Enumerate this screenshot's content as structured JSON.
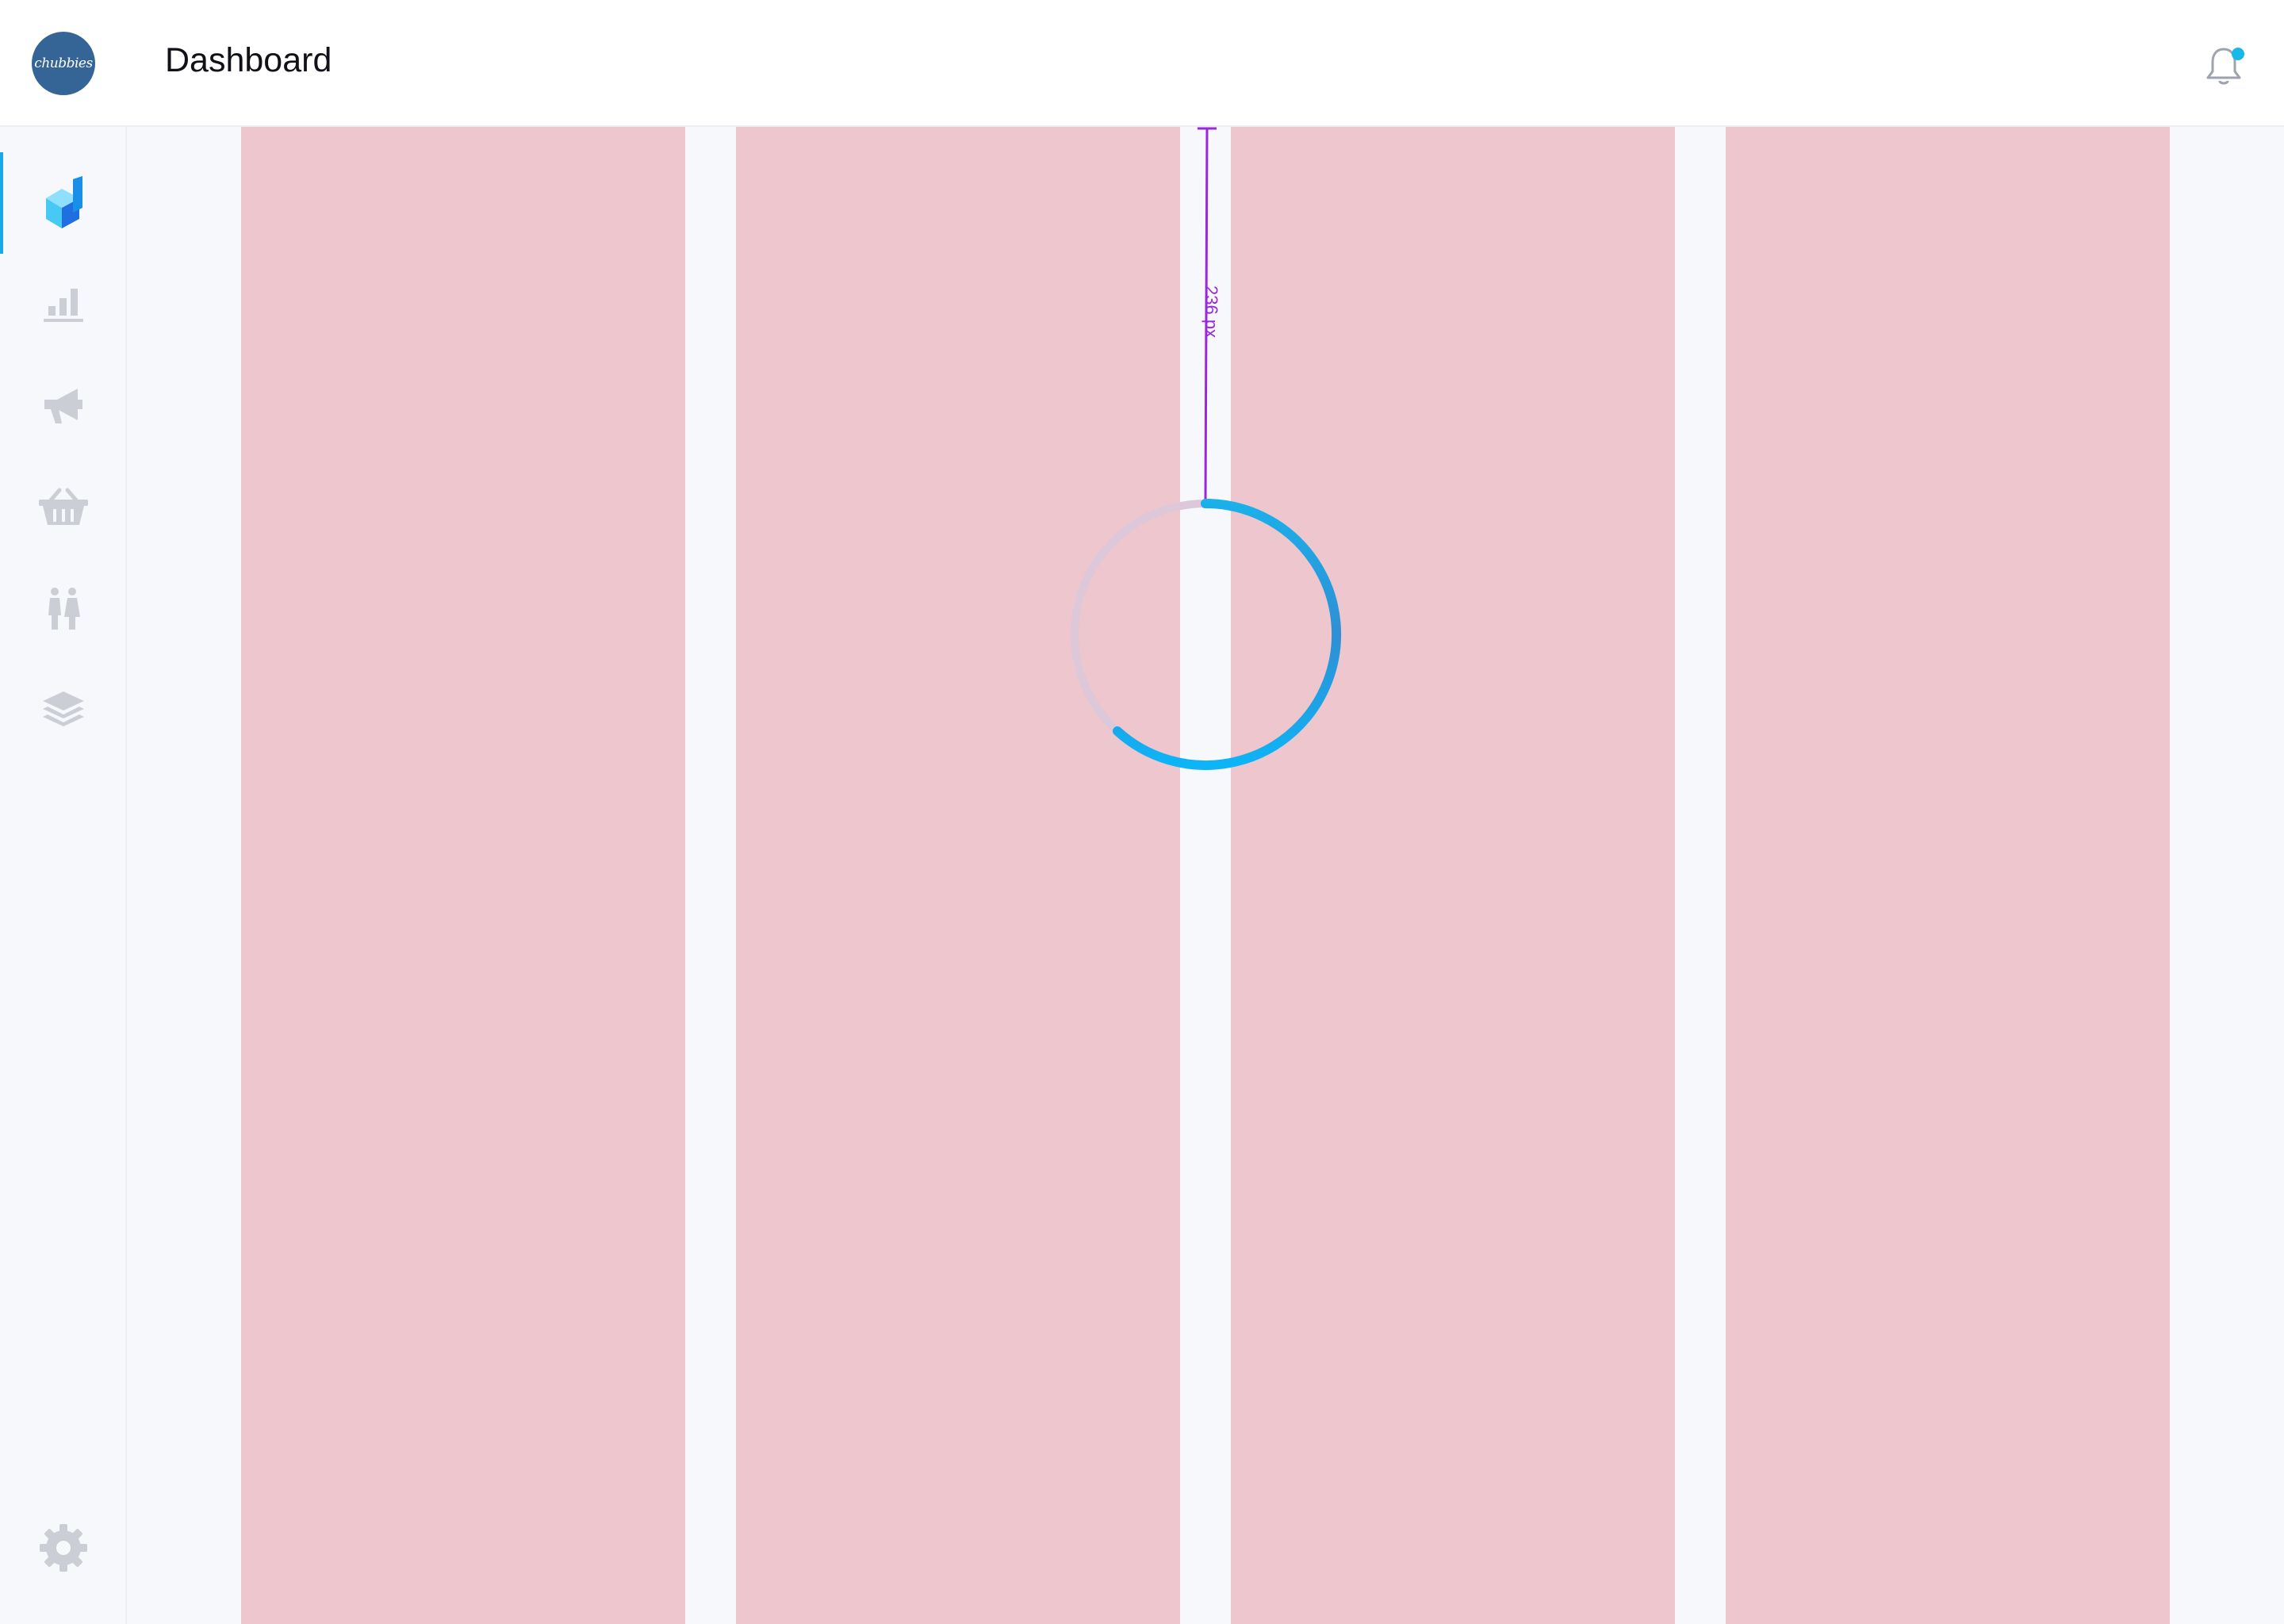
{
  "sidebar": {
    "logo_text": "chubbies",
    "nav": [
      {
        "icon": "brand-cube-icon",
        "active": true
      },
      {
        "icon": "bar-chart-icon",
        "active": false
      },
      {
        "icon": "megaphone-icon",
        "active": false
      },
      {
        "icon": "basket-icon",
        "active": false
      },
      {
        "icon": "people-icon",
        "active": false
      },
      {
        "icon": "layers-icon",
        "active": false
      }
    ],
    "settings_icon": "gear-icon"
  },
  "header": {
    "title": "Dashboard",
    "notification_icon": "bell-icon",
    "has_unread": true
  },
  "main": {
    "loading": true,
    "spinner_icon": "loading-spinner-icon",
    "measurement": {
      "label": "236 px"
    }
  },
  "colors": {
    "accent": "#1aa7e6",
    "grid_column": "#eec6cd",
    "measure": "#9b27dc",
    "logo_bg": "#356596",
    "icon_muted": "#cbced4"
  }
}
